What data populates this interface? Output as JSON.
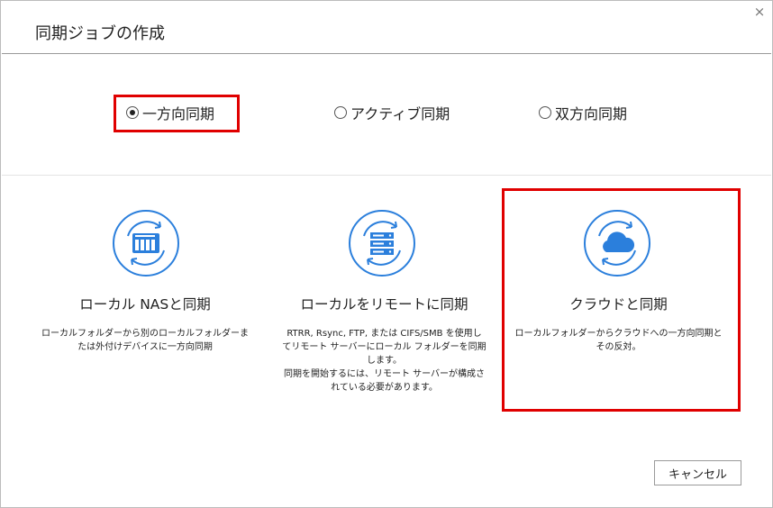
{
  "dialog": {
    "title": "同期ジョブの作成",
    "close_symbol": "×"
  },
  "sync_modes": [
    {
      "label": "一方向同期",
      "checked": true
    },
    {
      "label": "アクティブ同期",
      "checked": false
    },
    {
      "label": "双方向同期",
      "checked": false
    }
  ],
  "cards": [
    {
      "icon": "nas-device-icon",
      "title": "ローカル NASと同期",
      "description": "ローカルフォルダーから別のローカルフォルダーま\nたは外付けデバイスに一方向同期"
    },
    {
      "icon": "server-icon",
      "title": "ローカルをリモートに同期",
      "description": "RTRR, Rsync, FTP, または CIFS/SMB を使用し\nてリモート サーバーにローカル フォルダーを同期\nします。\n同期を開始するには、リモート サーバーが構成さ\nれている必要があります。"
    },
    {
      "icon": "cloud-icon",
      "title": "クラウドと同期",
      "description": "ローカルフォルダーからクラウドへの一方向同期と\nその反対。"
    }
  ],
  "footer": {
    "cancel_label": "キャンセル"
  },
  "colors": {
    "icon_blue": "#2b7fdc",
    "highlight_red": "#e00000"
  }
}
